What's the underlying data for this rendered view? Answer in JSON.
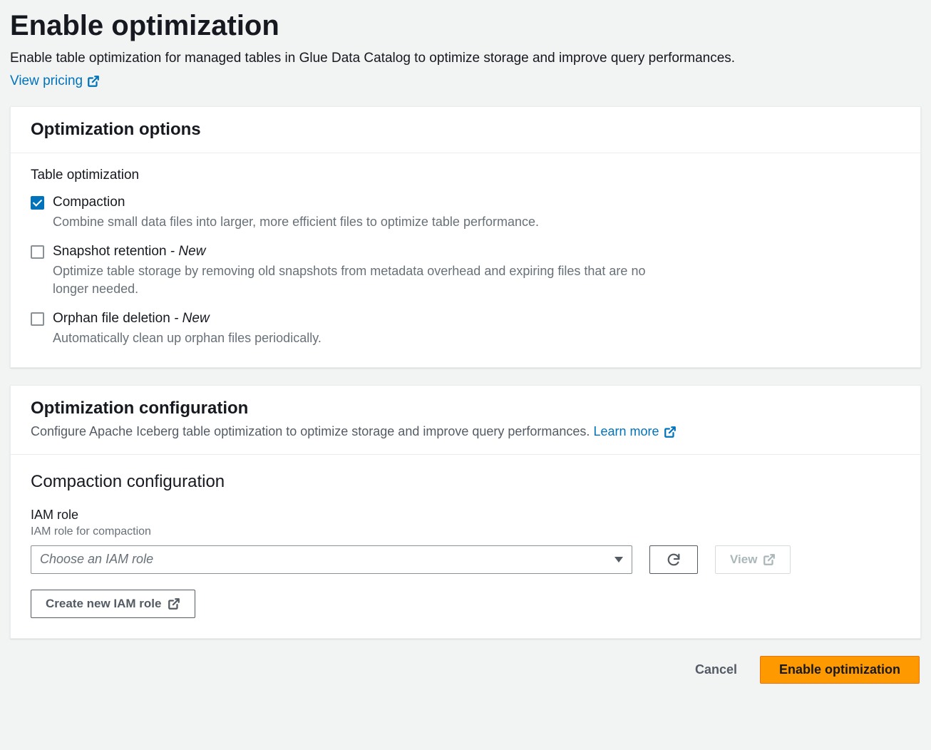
{
  "page": {
    "title": "Enable optimization",
    "subtitle": "Enable table optimization for managed tables in Glue Data Catalog to optimize storage and improve query performances.",
    "view_pricing_label": "View pricing"
  },
  "options_panel": {
    "title": "Optimization options",
    "group_label": "Table optimization",
    "items": [
      {
        "label": "Compaction",
        "new": false,
        "description": "Combine small data files into larger, more efficient files to optimize table performance.",
        "checked": true
      },
      {
        "label": "Snapshot retention",
        "new": true,
        "description": "Optimize table storage by removing old snapshots from metadata overhead and expiring files that are no longer needed.",
        "checked": false
      },
      {
        "label": "Orphan file deletion",
        "new": true,
        "description": "Automatically clean up orphan files periodically.",
        "checked": false
      }
    ],
    "new_tag": "- New"
  },
  "config_panel": {
    "title": "Optimization configuration",
    "description": "Configure Apache Iceberg table optimization to optimize storage and improve query performances.",
    "learn_more_label": "Learn more",
    "section_title": "Compaction configuration",
    "iam_label": "IAM role",
    "iam_hint": "IAM role for compaction",
    "select_placeholder": "Choose an IAM role",
    "view_button_label": "View",
    "create_role_label": "Create new IAM role"
  },
  "footer": {
    "cancel": "Cancel",
    "enable": "Enable optimization"
  }
}
